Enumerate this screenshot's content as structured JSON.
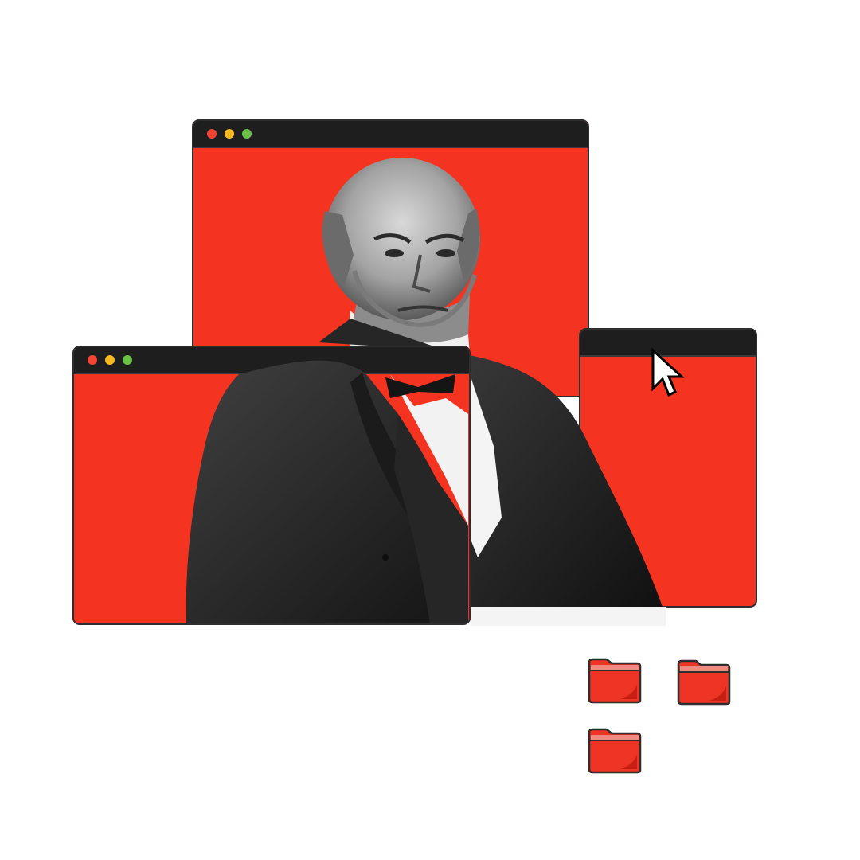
{
  "colors": {
    "window_fill": "#f43420",
    "titlebar": "#1e1e1e",
    "outline": "#2e2e2e",
    "dot_close": "#f24536",
    "dot_minimize": "#f5b820",
    "dot_zoom": "#6cc04a",
    "folder_fill": "#ee3424",
    "folder_tab": "#f08a80"
  },
  "windows": [
    {
      "id": "back-window",
      "dots": [
        "close",
        "minimize",
        "zoom"
      ]
    },
    {
      "id": "right-window",
      "dots": []
    },
    {
      "id": "front-window",
      "dots": [
        "close",
        "minimize",
        "zoom"
      ]
    }
  ],
  "icons": {
    "cursor": "arrow-cursor-icon",
    "folders": [
      "folder-icon",
      "folder-icon",
      "folder-icon"
    ]
  }
}
